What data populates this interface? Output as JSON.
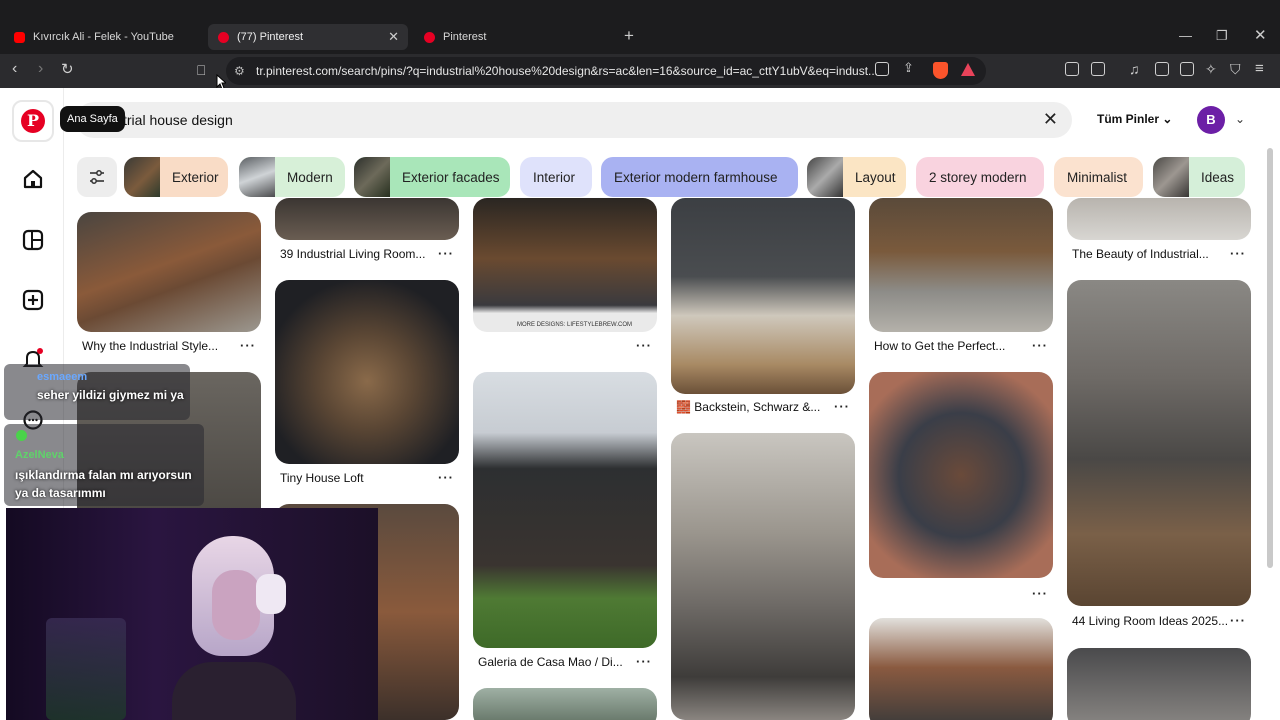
{
  "tabs": [
    {
      "title": "Kıvırcık Ali - Felek - YouTube",
      "favicon_color": "#ff0000"
    },
    {
      "title": "(77) Pinterest",
      "favicon_color": "#e60023"
    },
    {
      "title": "Pinterest",
      "favicon_color": "#e60023"
    }
  ],
  "toolbar": {
    "url": "tr.pinterest.com/search/pins/?q=industrial%20house%20design&rs=ac&len=16&source_id=ac_cttY1ubV&eq=indust..."
  },
  "nav": {
    "tooltip": "Ana Sayfa"
  },
  "search": {
    "query": "strial house design",
    "filter_label": "Tüm Pinler",
    "avatar_letter": "B"
  },
  "chips": [
    {
      "label": "Exterior",
      "color": "#f9dcc6"
    },
    {
      "label": "Modern",
      "color": "#d7f0d8"
    },
    {
      "label": "Exterior facades",
      "color": "#a9e6b9"
    },
    {
      "label": "Interior",
      "color": "#dfe2fb"
    },
    {
      "label": "Exterior modern farmhouse",
      "color": "#a9b2f2"
    },
    {
      "label": "Layout",
      "color": "#fbe5c4"
    },
    {
      "label": "2 storey modern",
      "color": "#f9d3df"
    },
    {
      "label": "Minimalist",
      "color": "#fbe2cf"
    },
    {
      "label": "Ideas",
      "color": "#d5efd9"
    }
  ],
  "pins": [
    {
      "caption": "Why the Industrial Style..."
    },
    {
      "caption": "39 Industrial Living Room..."
    },
    {
      "caption": "Tiny House Loft"
    },
    {
      "caption": "Galeria de Casa Mao / Di..."
    },
    {
      "caption": "🧱 Backstein, Schwarz &..."
    },
    {
      "caption": "How to Get the Perfect..."
    },
    {
      "caption": "The Beauty of Industrial..."
    },
    {
      "caption": "44 Living Room Ideas 2025..."
    }
  ],
  "pin_watermark": "MORE DESIGNS: LIFESTYLEBREW.COM",
  "overlay": {
    "chat": [
      {
        "user": "esmaeem",
        "message": "seher yildizi giymez mi ya",
        "color": "#6aa8ff"
      },
      {
        "user": "AzelNeva",
        "message": "ışıklandırma falan mı arıyorsun ya da tasarımmı",
        "color": "#5fd36a"
      }
    ]
  }
}
